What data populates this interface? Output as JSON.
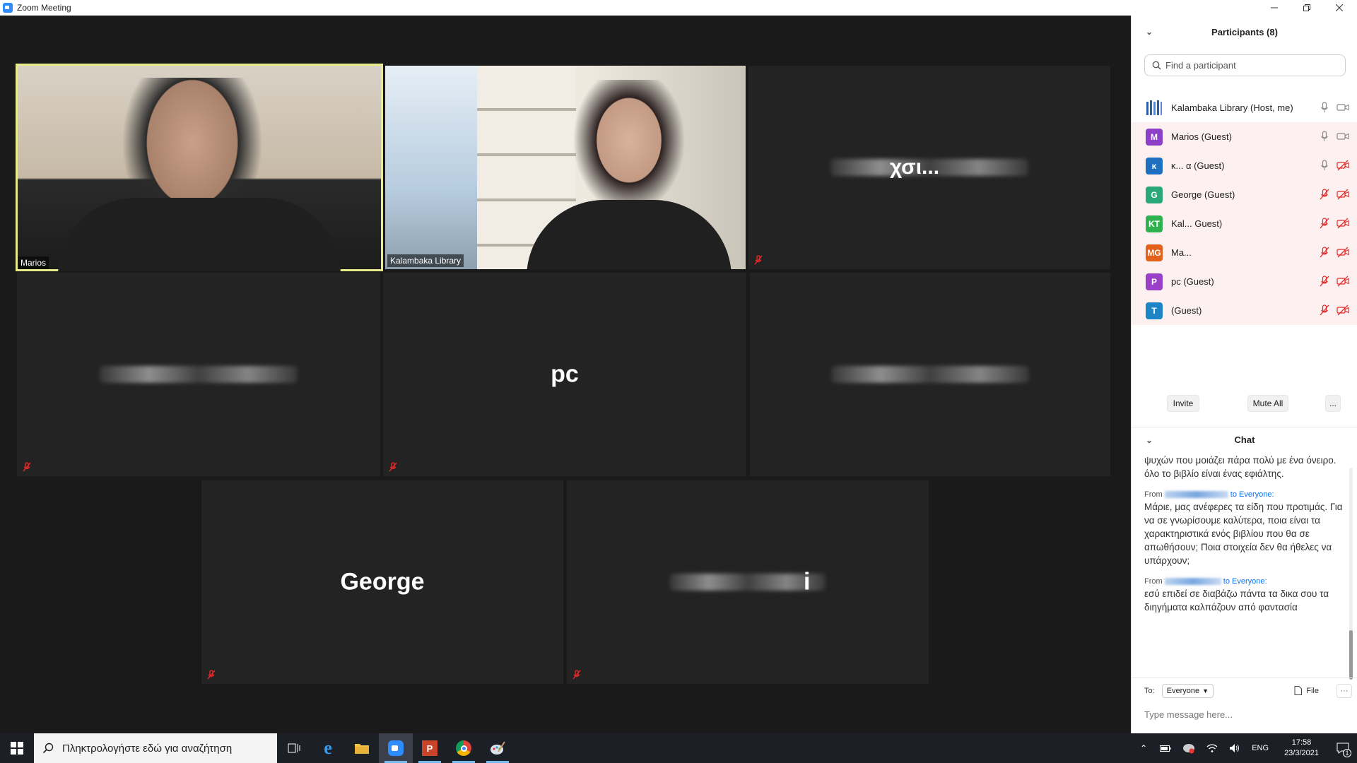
{
  "window": {
    "title": "Zoom Meeting",
    "controls": [
      "minimize",
      "restore",
      "close"
    ]
  },
  "tiles": [
    {
      "id": "marios",
      "label": "Marios",
      "video": true,
      "speaking": true
    },
    {
      "id": "library",
      "label": "Kalambaka Library",
      "video": true,
      "speaking": false
    },
    {
      "id": "t3",
      "display_name": "Τ... χσι...",
      "video": false,
      "muted": true
    },
    {
      "id": "t4",
      "display_name": "K... Th...d...",
      "video": false,
      "muted": true
    },
    {
      "id": "pc",
      "display_name": "pc",
      "video": false,
      "muted": true
    },
    {
      "id": "t6",
      "display_name": "κ...",
      "video": false,
      "muted": false
    },
    {
      "id": "george",
      "display_name": "George",
      "video": false,
      "muted": true
    },
    {
      "id": "t8",
      "display_name": "...i",
      "video": false,
      "muted": true
    }
  ],
  "participants_panel": {
    "title": "Participants (8)",
    "search_placeholder": "Find a participant",
    "participants": [
      {
        "name": "Kalambaka Library (Host, me)",
        "initials": "",
        "color": "#2d5fa8",
        "mic": "on",
        "cam": "on",
        "highlight": false
      },
      {
        "name": "Marios (Guest)",
        "initials": "M",
        "color": "#8e3fc7",
        "mic": "on",
        "cam": "on",
        "highlight": true
      },
      {
        "name": "κ... α (Guest)",
        "initials": "κ",
        "color": "#1f6fc0",
        "mic": "on",
        "cam": "off",
        "highlight": true
      },
      {
        "name": "George (Guest)",
        "initials": "G",
        "color": "#2aa87a",
        "mic": "off",
        "cam": "off",
        "highlight": true
      },
      {
        "name": "Kal... Guest)",
        "initials": "KT",
        "color": "#2fb150",
        "mic": "off",
        "cam": "off",
        "highlight": true
      },
      {
        "name": "Ma...",
        "initials": "MG",
        "color": "#e2621b",
        "mic": "off",
        "cam": "off",
        "highlight": true
      },
      {
        "name": "pc (Guest)",
        "initials": "P",
        "color": "#9a3fc7",
        "mic": "off",
        "cam": "off",
        "highlight": true
      },
      {
        "name": "(Guest)",
        "initials": "T",
        "color": "#1d84c6",
        "mic": "off",
        "cam": "off",
        "highlight": true
      }
    ],
    "buttons": {
      "invite": "Invite",
      "mute_all": "Mute All",
      "more": "..."
    }
  },
  "chat": {
    "title": "Chat",
    "messages": [
      {
        "from_prefix": "",
        "to": "",
        "text": "ψυχών που μοιάζει πάρα πολύ με ένα όνειρο. όλο το βιβλίο είναι ένας εφιάλτης."
      },
      {
        "from_prefix": "From",
        "to": "to Everyone:",
        "text": "Μάριε, μας ανέφερες τα είδη που προτιμάς. Για να σε γνωρίσουμε καλύτερα, ποια είναι τα χαρακτηριστικά ενός βιβλίου που θα σε απωθήσουν; Ποια στοιχεία δεν θα ήθελες να υπάρχουν;"
      },
      {
        "from_prefix": "From",
        "to": "to Everyone:",
        "text": "εσύ επιδεί σε διαβάζω πάντα τα δικα σου τα διηγήματα καλπάζουν από φαντασία"
      }
    ],
    "to_label": "To:",
    "to_value": "Everyone",
    "file_label": "File",
    "more_label": "···",
    "input_placeholder": "Type message here..."
  },
  "taskbar": {
    "search_placeholder": "Πληκτρολογήστε εδώ για αναζήτηση",
    "language": "ENG",
    "time": "17:58",
    "date": "23/3/2021",
    "notifications": "1"
  }
}
